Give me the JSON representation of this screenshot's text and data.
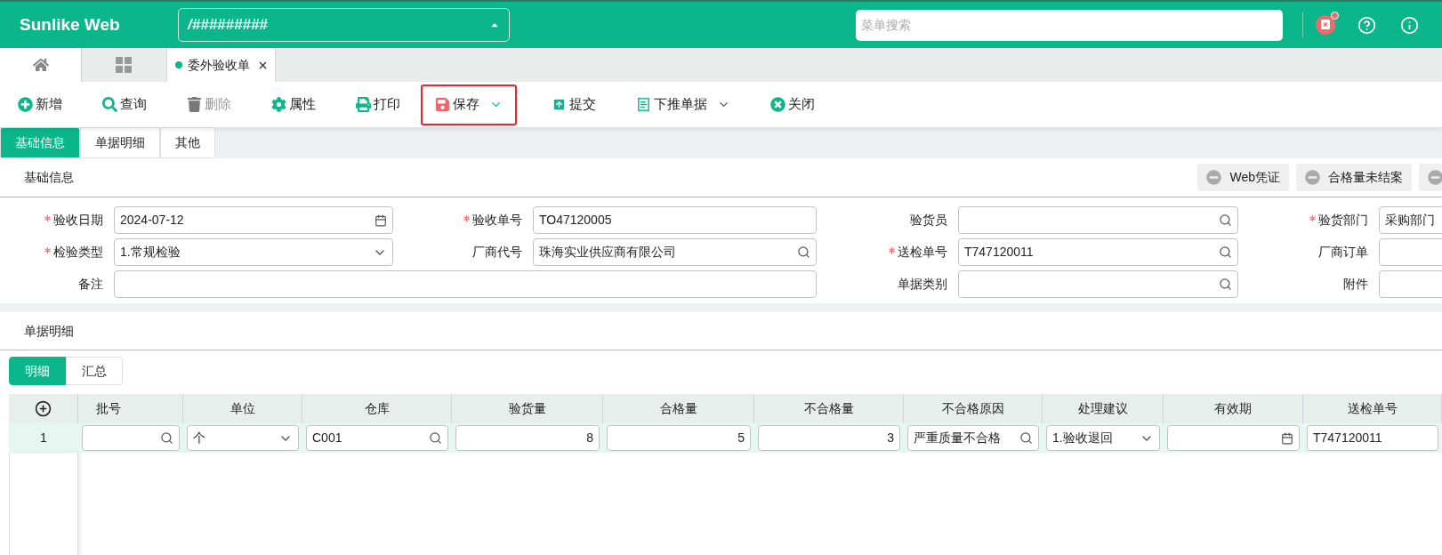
{
  "header": {
    "logo": "Sunlike Web",
    "path_select": "/#########",
    "search": {
      "placeholder": "菜单搜索"
    },
    "alert_badge": true
  },
  "open_tabs": [
    {
      "label": "委外验收单",
      "selected": true
    }
  ],
  "toolbar": [
    {
      "label": "新增",
      "disabled": false,
      "highlighted": false,
      "has_menu": false
    },
    {
      "label": "查询",
      "disabled": false,
      "highlighted": false,
      "has_menu": false
    },
    {
      "label": "删除",
      "disabled": true,
      "highlighted": false,
      "has_menu": false
    },
    {
      "label": "属性",
      "disabled": false,
      "highlighted": false,
      "has_menu": false
    },
    {
      "label": "打印",
      "disabled": false,
      "highlighted": false,
      "has_menu": false
    },
    {
      "label": "保存",
      "disabled": false,
      "highlighted": true,
      "has_menu": true
    },
    {
      "label": "提交",
      "disabled": false,
      "highlighted": false,
      "has_menu": false
    },
    {
      "label": "下推单据",
      "disabled": false,
      "highlighted": false,
      "has_menu": true
    },
    {
      "label": "关闭",
      "disabled": false,
      "highlighted": false,
      "has_menu": false
    }
  ],
  "form_tabs": [
    {
      "label": "基础信息",
      "selected": true
    },
    {
      "label": "单据明细",
      "selected": false
    },
    {
      "label": "其他",
      "selected": false
    }
  ],
  "basic_section": {
    "title": "基础信息",
    "chips": [
      {
        "kind": "labeled",
        "label": "Web凭证"
      },
      {
        "kind": "labeled",
        "label": "合格量未结案"
      },
      {
        "kind": "icon_only"
      }
    ],
    "rows": [
      [
        {
          "label": "验收日期",
          "required": true,
          "kind": "date",
          "value": "2024-07-12"
        },
        {
          "label": "验收单号",
          "required": true,
          "kind": "text",
          "value": "TO47120005"
        },
        {
          "label": "验货员",
          "required": false,
          "kind": "lookup"
        },
        {
          "label": "验货部门",
          "required": true,
          "kind": "text",
          "value": "采购部门"
        }
      ],
      [
        {
          "label": "检验类型",
          "required": true,
          "kind": "select",
          "value": "1.常规检验"
        },
        {
          "label": "厂商代号",
          "required": false,
          "kind": "lookup",
          "value": "珠海实业供应商有限公司"
        },
        {
          "label": "送检单号",
          "required": true,
          "kind": "lookup",
          "value": "T747120011"
        },
        {
          "label": "厂商订单",
          "required": false,
          "kind": "text"
        }
      ],
      [
        {
          "label": "备注",
          "required": false,
          "kind": "text"
        },
        "",
        {
          "label": "单据类别",
          "required": false,
          "kind": "lookup"
        },
        {
          "label": "附件",
          "required": false,
          "kind": "text"
        }
      ]
    ]
  },
  "detail_section": {
    "title": "单据明细",
    "tabs": [
      {
        "label": "明细",
        "selected": true
      },
      {
        "label": "汇总",
        "selected": false
      }
    ],
    "table": {
      "columns": [
        "批号",
        "单位",
        "仓库",
        "验货量",
        "合格量",
        "不合格量",
        "不合格原因",
        "处理建议",
        "有效期",
        "送检单号"
      ],
      "rows": [
        {
          "number": "1",
          "selected": true,
          "cells": [
            {
              "kind": "lookup"
            },
            {
              "kind": "select",
              "value": "个"
            },
            {
              "kind": "lookup",
              "value": "C001"
            },
            {
              "kind": "number",
              "value": "8"
            },
            {
              "kind": "number",
              "value": "5"
            },
            {
              "kind": "number",
              "value": "3"
            },
            {
              "kind": "lookup",
              "value": "严重质量不合格"
            },
            {
              "kind": "select",
              "value": "1.验收退回"
            },
            {
              "kind": "date"
            },
            {
              "kind": "text",
              "value": "T747120011"
            }
          ]
        }
      ]
    }
  }
}
